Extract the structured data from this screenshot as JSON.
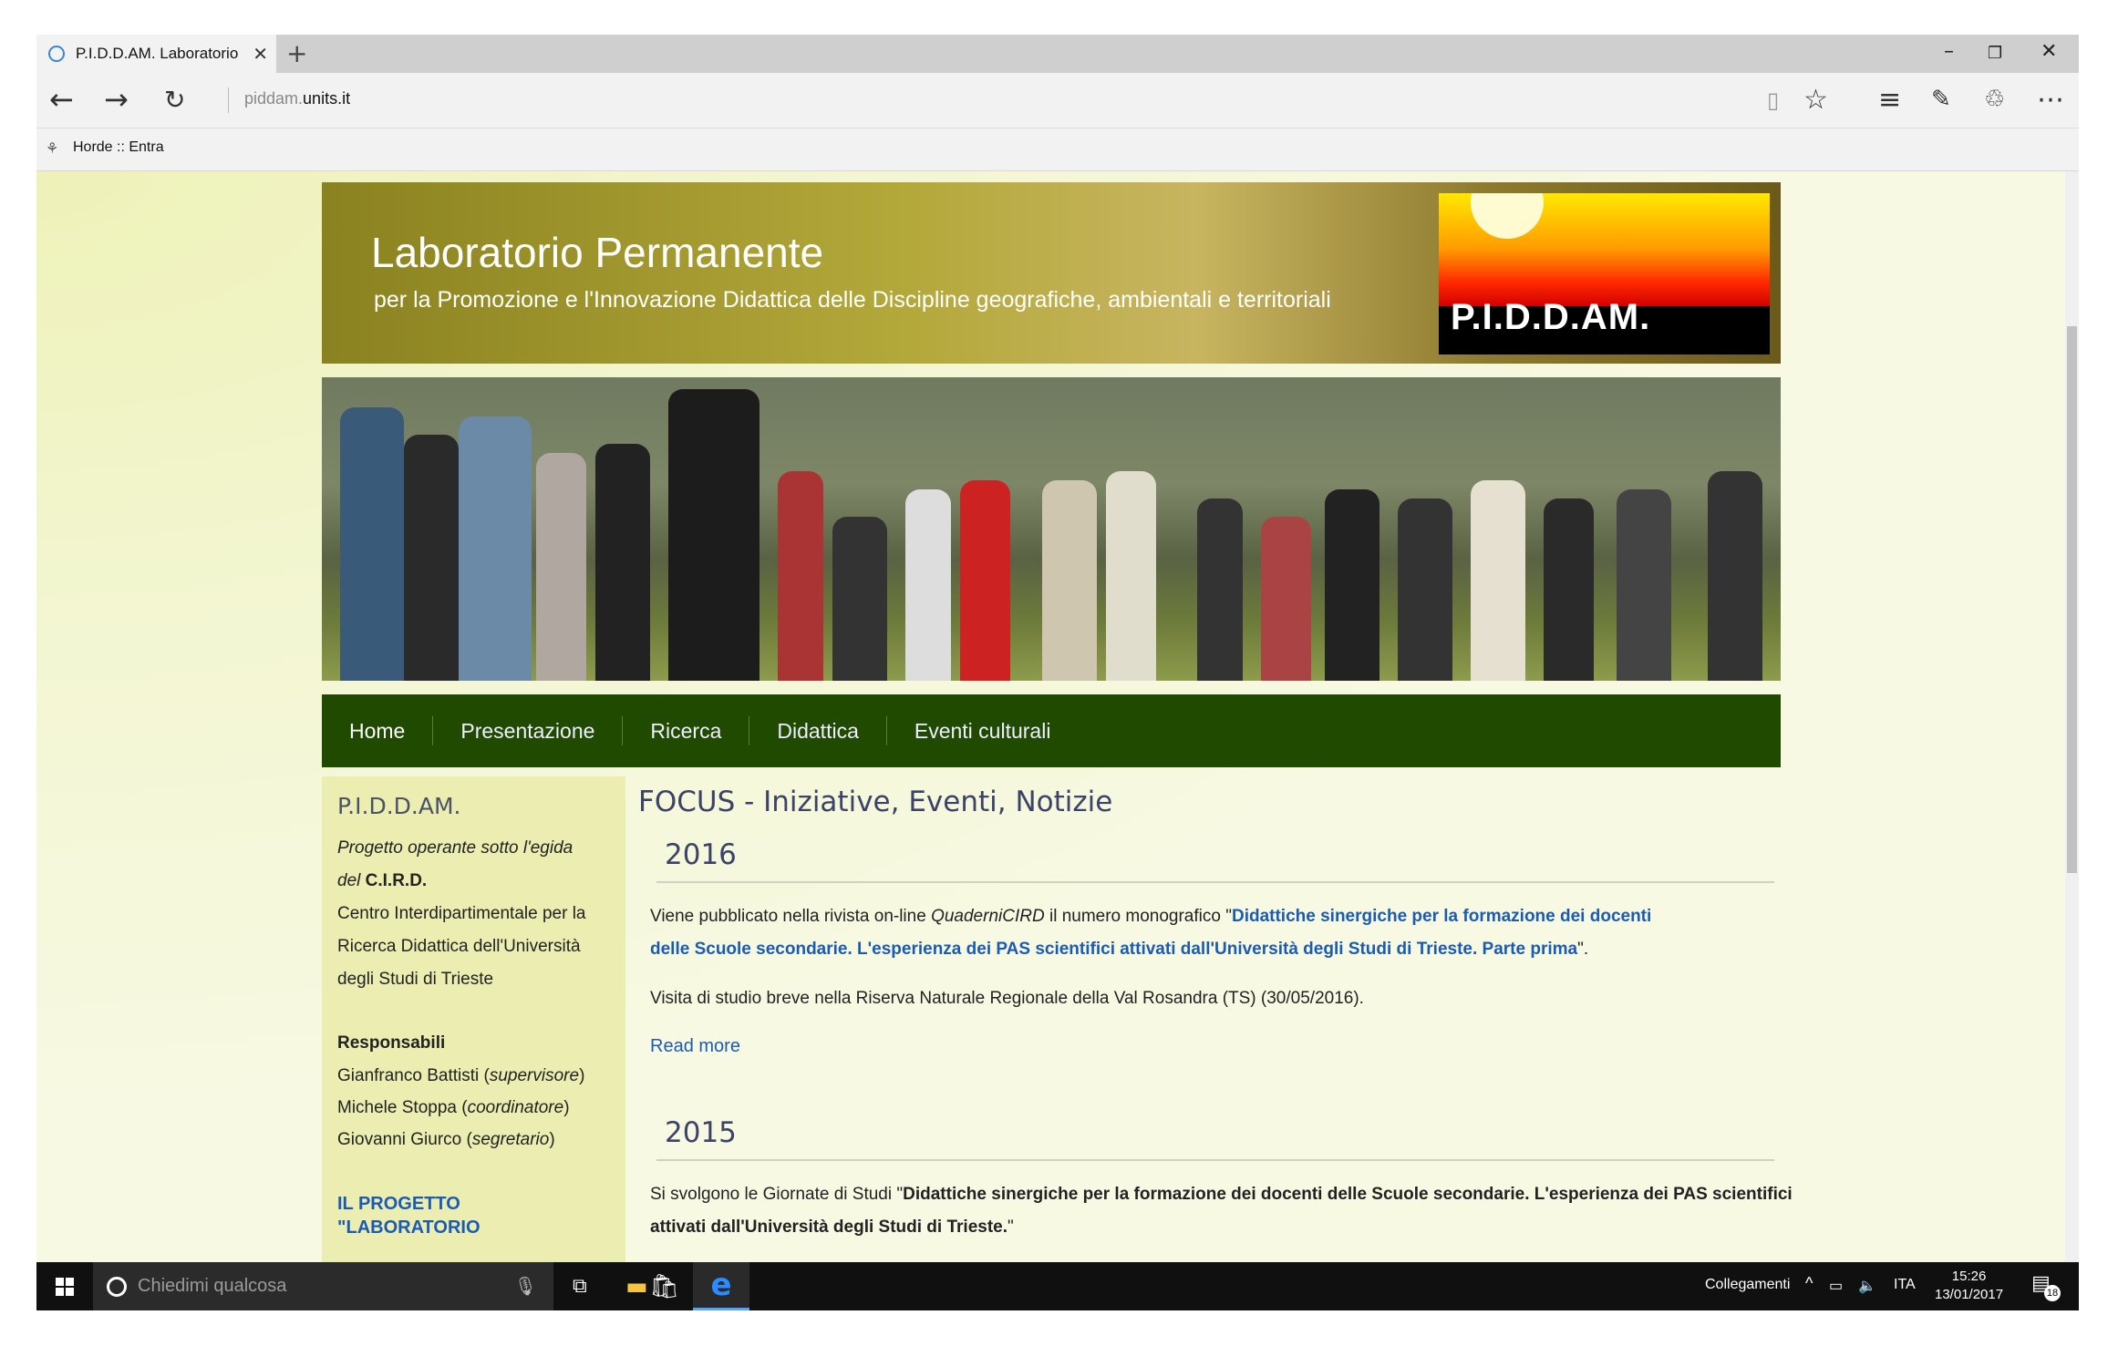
{
  "browser": {
    "tab_title": "P.I.D.D.AM. Laboratorio",
    "tab_close": "✕",
    "new_tab": "+",
    "url_prefix": "piddam.",
    "url_domain": "units.it",
    "favorite": "Horde :: Entra",
    "win_min": "–",
    "win_restore": "❐",
    "win_close": "✕"
  },
  "header": {
    "title": "Laboratorio Permanente",
    "subtitle": "per la Promozione e l'Innovazione Didattica delle Discipline geografiche, ambientali e territoriali",
    "logo_text": "P.I.D.D.AM."
  },
  "nav": {
    "items": [
      "Home",
      "Presentazione",
      "Ricerca",
      "Didattica",
      "Eventi culturali"
    ]
  },
  "sidebar": {
    "title": "P.I.D.D.AM.",
    "intro_italic": "Progetto operante sotto l'egida",
    "intro_del": "del",
    "intro_bold": "C.I.R.D.",
    "center_line1": "Centro Interdipartimentale per la",
    "center_line2": "Ricerca Didattica dell'Università",
    "center_line3": "degli Studi di Trieste",
    "responsabili_title": "Responsabili",
    "resp1_name": "Gianfranco Battisti (",
    "resp1_role": "supervisore",
    "resp2_name": "Michele Stoppa (",
    "resp2_role": "coordinatore",
    "resp3_name": "Giovanni Giurco (",
    "resp3_role": "segretario",
    "close_paren": ")",
    "link_line1": "IL PROGETTO",
    "link_line2": "\"LABORATORIO"
  },
  "main": {
    "title": "FOCUS - Iniziative, Eventi, Notizie",
    "sections": [
      {
        "year": "2016",
        "p1_start": "Viene pubblicato nella rivista on-line ",
        "p1_italic": "QuaderniCIRD",
        "p1_mid": " il numero monografico \"",
        "p1_link1": "Didattiche sinergiche per la formazione dei docenti",
        "p1_link2": "delle Scuole secondarie. L'esperienza dei PAS scientifici attivati dall'Università degli Studi di Trieste. Parte prima",
        "p1_end": "\".",
        "p2": "Visita di studio breve nella Riserva Naturale Regionale della Val Rosandra (TS) (30/05/2016).",
        "read_more": "Read more"
      },
      {
        "year": "2015",
        "p1_start": "Si svolgono le Giornate di Studi \"",
        "p1_bold1": "Didattiche sinergiche per la formazione dei docenti delle Scuole secondarie. L'esperienza dei PAS scientifici",
        "p1_bold2": "attivati dall'Università degli Studi di Trieste.",
        "p1_end": "\""
      }
    ]
  },
  "taskbar": {
    "search_placeholder": "Chiedimi qualcosa",
    "tray_links": "Collegamenti",
    "language": "ITA",
    "time": "15:26",
    "date": "13/01/2017",
    "notifications": "18"
  },
  "colors": {
    "nav_bg": "#1f4a00",
    "link": "#1a5bb4",
    "sidebar_bg": "#ecedb0",
    "page_bg": "#f7f9e2"
  }
}
